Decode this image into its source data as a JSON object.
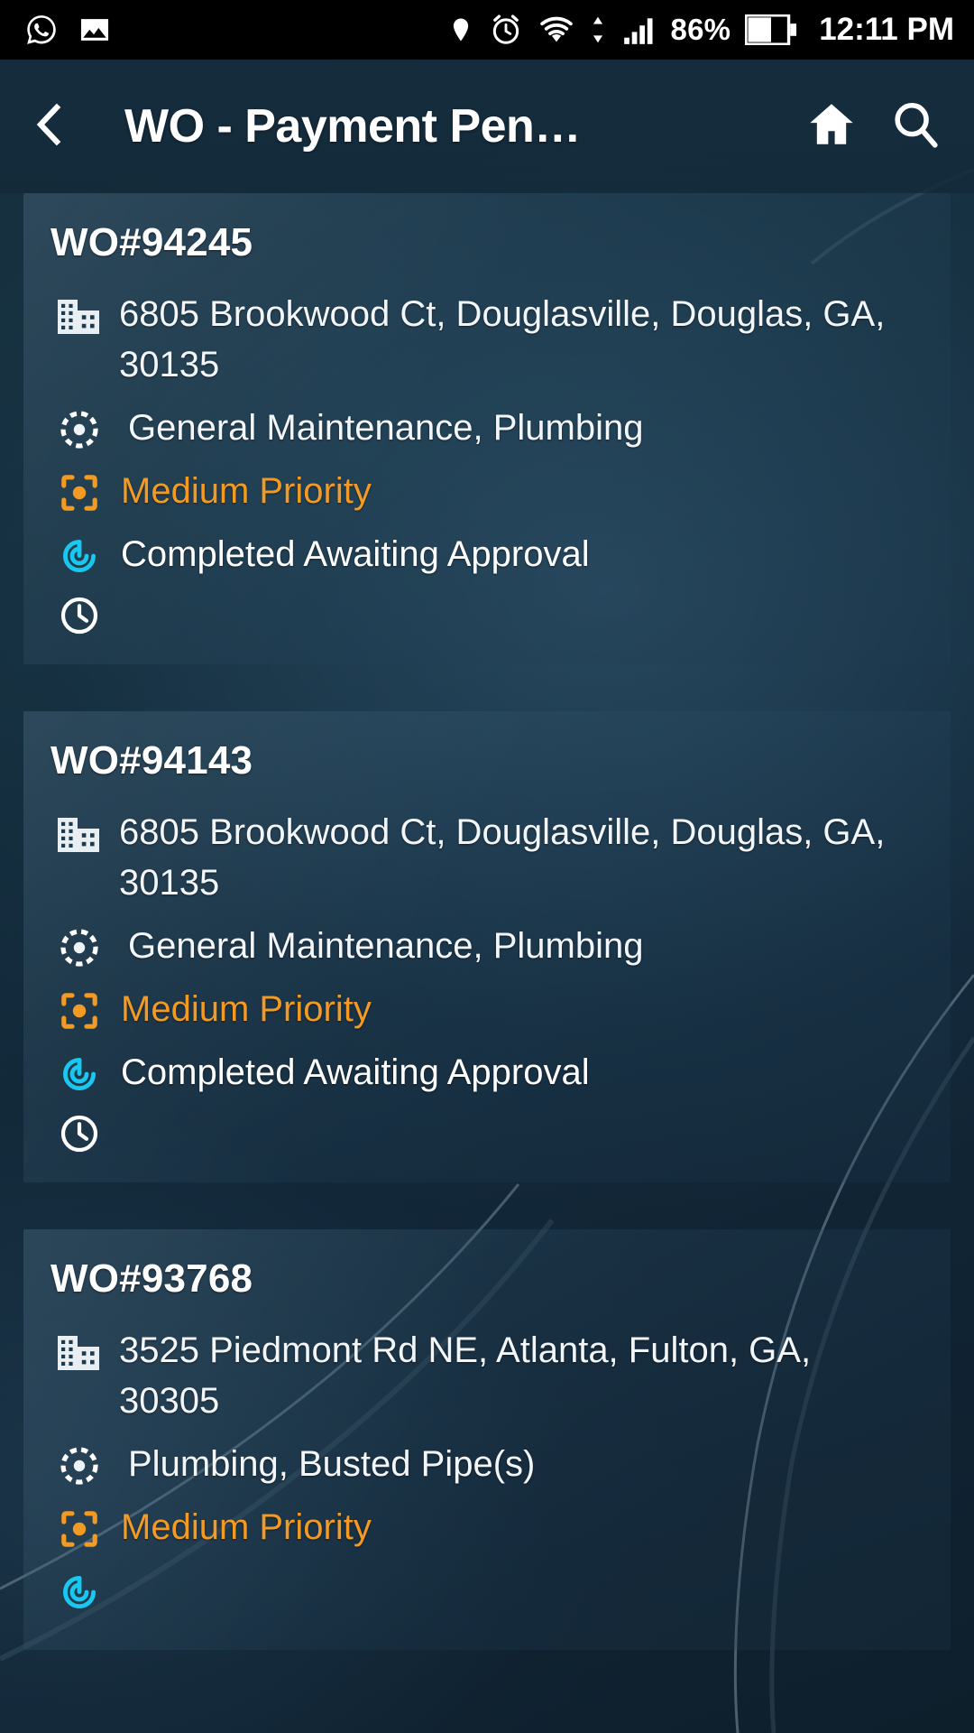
{
  "statusbar": {
    "left_icons": [
      "whatsapp-icon",
      "gallery-image-icon"
    ],
    "right_icons": [
      "location-pin-icon",
      "alarm-clock-icon",
      "wifi-icon",
      "data-transfer-icon",
      "cell-signal-icon"
    ],
    "battery_percent": "86%",
    "battery_icon": "battery-icon",
    "time": "12:11 PM"
  },
  "appbar": {
    "back_icon": "back-arrow-icon",
    "title": "WO - Payment Pen…",
    "home_icon": "home-icon",
    "search_icon": "search-icon"
  },
  "work_orders": [
    {
      "id": "WO#94245",
      "address": "6805 Brookwood Ct, Douglasville, Douglas, GA, 30135",
      "category": "General Maintenance, Plumbing",
      "priority": "Medium Priority",
      "status": "Completed Awaiting Approval",
      "time": "",
      "icons": {
        "address": "building-icon",
        "category": "category-target-icon",
        "priority": "priority-focus-icon",
        "status": "status-spiral-icon",
        "time": "clock-icon"
      }
    },
    {
      "id": "WO#94143",
      "address": "6805 Brookwood Ct, Douglasville, Douglas, GA, 30135",
      "category": "General Maintenance, Plumbing",
      "priority": "Medium Priority",
      "status": "Completed Awaiting Approval",
      "time": "",
      "icons": {
        "address": "building-icon",
        "category": "category-target-icon",
        "priority": "priority-focus-icon",
        "status": "status-spiral-icon",
        "time": "clock-icon"
      }
    },
    {
      "id": "WO#93768",
      "address": "3525 Piedmont Rd NE, Atlanta, Fulton, GA, 30305",
      "category": "Plumbing, Busted Pipe(s)",
      "priority": "Medium Priority",
      "status": "",
      "time": "",
      "icons": {
        "address": "building-icon",
        "category": "category-target-icon",
        "priority": "priority-focus-icon",
        "status": "status-spiral-icon",
        "time": "clock-icon"
      }
    }
  ],
  "colors": {
    "priority_orange": "#f29a24",
    "status_cyan": "#18c8f0",
    "appbar_bg": "#16303f",
    "page_bg": "#12293a",
    "text_white": "#ffffff"
  }
}
